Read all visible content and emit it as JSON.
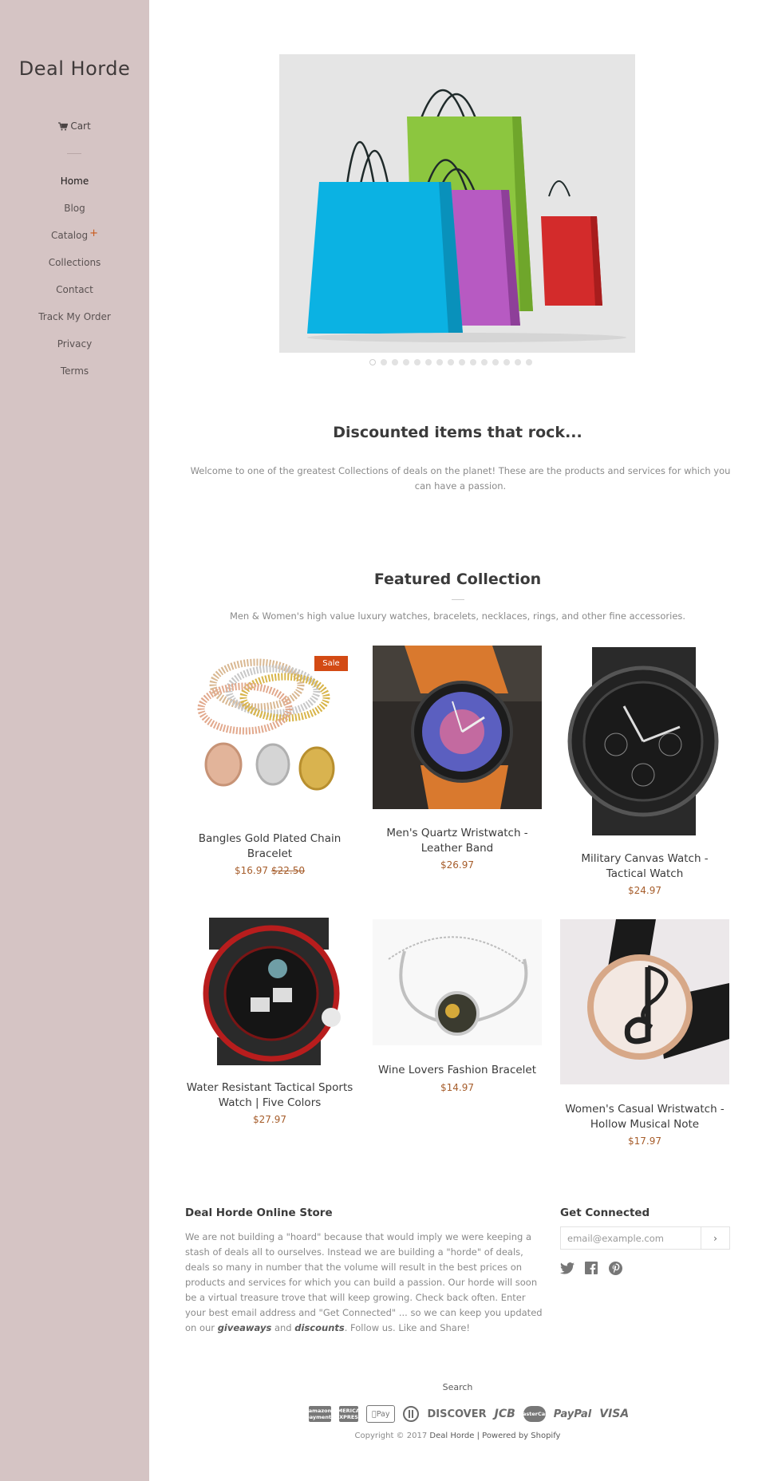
{
  "sidebar": {
    "logo": "Deal Horde",
    "cart_label": "Cart",
    "nav": [
      {
        "label": "Home",
        "active": true
      },
      {
        "label": "Blog"
      },
      {
        "label": "Catalog",
        "has_children": true
      },
      {
        "label": "Collections"
      },
      {
        "label": "Contact"
      },
      {
        "label": "Track My Order"
      },
      {
        "label": "Privacy"
      },
      {
        "label": "Terms"
      }
    ],
    "bg_color": "#d5c4c4"
  },
  "slideshow": {
    "slide_count": 15,
    "active_index": 0,
    "image": "colorful-shopping-bags"
  },
  "intro": {
    "title": "Discounted items that rock...",
    "text": "Welcome to one of the greatest Collections of deals on the planet! These are the products and services for which you can have a passion."
  },
  "featured": {
    "title": "Featured Collection",
    "description": "Men & Women's high value luxury watches, bracelets, necklaces, rings, and other fine accessories.",
    "products": [
      {
        "name": "Bangles Gold Plated Chain Bracelet",
        "price": "$16.97",
        "compare_price": "$22.50",
        "badge": "Sale",
        "image": "bangles-bracelet"
      },
      {
        "name": "Men's Quartz Wristwatch - Leather Band",
        "price": "$26.97",
        "image": "quartz-wristwatch"
      },
      {
        "name": "Military Canvas Watch - Tactical Watch",
        "price": "$24.97",
        "image": "military-canvas-watch"
      },
      {
        "name": "Water Resistant Tactical Sports Watch | Five Colors",
        "price": "$27.97",
        "image": "tactical-sports-watch"
      },
      {
        "name": "Wine Lovers Fashion Bracelet",
        "price": "$14.97",
        "image": "wine-lovers-bracelet"
      },
      {
        "name": "Women's Casual Wristwatch - Hollow Musical Note",
        "price": "$17.97",
        "image": "musical-note-watch"
      }
    ],
    "price_color": "#a65d2b",
    "sale_color": "#d34a14"
  },
  "footer": {
    "about_title": "Deal Horde Online Store",
    "about_text_1": "We are not building a \"hoard\" because that would imply we were keeping a stash of deals all to ourselves. Instead we are building a \"horde\" of deals, deals so many in number that the volume will result in the best prices on products and services for which you can build a passion. Our horde will soon be a virtual treasure trove that will keep growing. Check back often. Enter your best email address and \"Get Connected\" ... so we can keep you updated on our ",
    "about_em_1": "giveaways",
    "about_text_2": " and ",
    "about_em_2": "discounts",
    "about_text_3": ". Follow us. Like and Share!",
    "connect_title": "Get Connected",
    "email_placeholder": "email@example.com",
    "submit_glyph": "›",
    "social_icons": [
      "twitter-icon",
      "facebook-icon",
      "pinterest-icon"
    ],
    "search_label": "Search",
    "payment_icons": [
      {
        "name": "amazon-payments",
        "label": "amazon payments"
      },
      {
        "name": "american-express",
        "label": "AMERICAN EXPRESS"
      },
      {
        "name": "apple-pay",
        "label": "Pay"
      },
      {
        "name": "diners-club",
        "label": ""
      },
      {
        "name": "discover",
        "label": "DISCOVER"
      },
      {
        "name": "jcb",
        "label": "JCB"
      },
      {
        "name": "master",
        "label": "MasterCard"
      },
      {
        "name": "paypal",
        "label": "PayPal"
      },
      {
        "name": "visa",
        "label": "VISA"
      }
    ],
    "copyright_prefix": "Copyright © 2017",
    "copyright_store": "Deal Horde",
    "copyright_sep": "|",
    "powered_by": "Powered by Shopify"
  }
}
